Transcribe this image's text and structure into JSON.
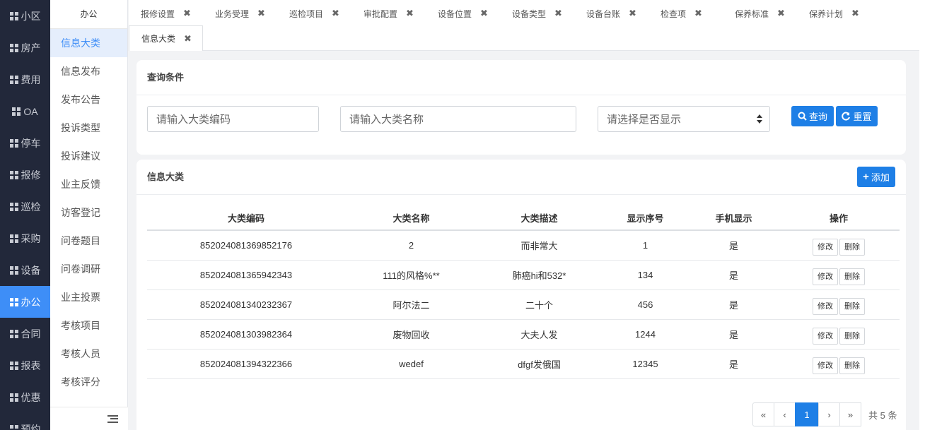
{
  "leftnav": [
    {
      "label": "小区",
      "active": false
    },
    {
      "label": "房产",
      "active": false
    },
    {
      "label": "费用",
      "active": false
    },
    {
      "label": "OA",
      "active": false
    },
    {
      "label": "停车",
      "active": false
    },
    {
      "label": "报修",
      "active": false
    },
    {
      "label": "巡检",
      "active": false
    },
    {
      "label": "采购",
      "active": false
    },
    {
      "label": "设备",
      "active": false
    },
    {
      "label": "办公",
      "active": true
    },
    {
      "label": "合同",
      "active": false
    },
    {
      "label": "报表",
      "active": false
    },
    {
      "label": "优惠",
      "active": false
    },
    {
      "label": "预约",
      "active": false
    }
  ],
  "submenu": {
    "title": "办公",
    "items": [
      "信息大类",
      "信息发布",
      "发布公告",
      "投诉类型",
      "投诉建议",
      "业主反馈",
      "访客登记",
      "问卷题目",
      "问卷调研",
      "业主投票",
      "考核项目",
      "考核人员",
      "考核评分"
    ],
    "active_index": 0
  },
  "tabs": {
    "row1": [
      "报修设置",
      "业务受理",
      "巡检项目",
      "审批配置",
      "设备位置",
      "设备类型",
      "设备台账",
      "检查项",
      "保养标准",
      "保养计划"
    ],
    "active": "信息大类",
    "close_glyph": "✖"
  },
  "query": {
    "title": "查询条件",
    "code_placeholder": "请输入大类编码",
    "name_placeholder": "请输入大类名称",
    "show_placeholder": "请选择是否显示",
    "search_label": "查询",
    "reset_label": "重置"
  },
  "list": {
    "title": "信息大类",
    "add_label": "添加",
    "columns": [
      "大类编码",
      "大类名称",
      "大类描述",
      "显示序号",
      "手机显示",
      "操作"
    ],
    "rows": [
      {
        "code": "852024081369852176",
        "name": "2",
        "desc": "而非常大",
        "seq": "1",
        "mobile": "是"
      },
      {
        "code": "852024081365942343",
        "name": "111的风格%**",
        "desc": "肺癌hi和532*",
        "seq": "134",
        "mobile": "是"
      },
      {
        "code": "852024081340232367",
        "name": "阿尔法二",
        "desc": "二十个",
        "seq": "456",
        "mobile": "是"
      },
      {
        "code": "852024081303982364",
        "name": "废物回收",
        "desc": "大夫人发",
        "seq": "1244",
        "mobile": "是"
      },
      {
        "code": "852024081394322366",
        "name": "wedef",
        "desc": "dfgf发俄国",
        "seq": "12345",
        "mobile": "是"
      }
    ],
    "edit_label": "修改",
    "delete_label": "删除"
  },
  "pager": {
    "first": "«",
    "prev": "‹",
    "current": "1",
    "next": "›",
    "last": "»",
    "total_text": "共 5 条"
  },
  "colors": {
    "nav_bg": "#22283a",
    "accent": "#3e8ef7",
    "button": "#1e7fe6"
  }
}
